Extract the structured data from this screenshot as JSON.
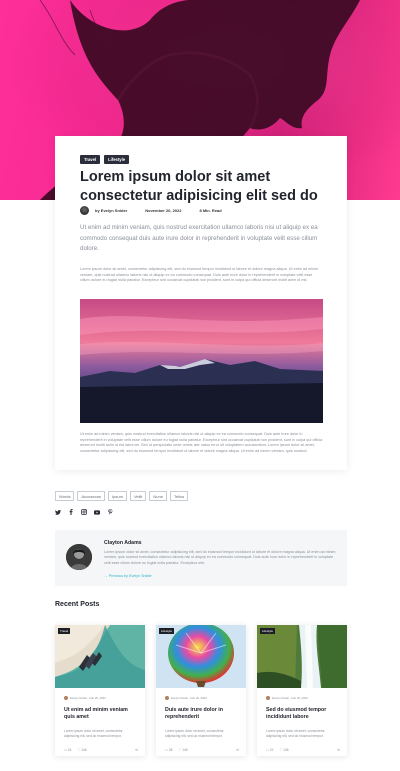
{
  "article": {
    "tags": [
      "Travel",
      "Lifestyle"
    ],
    "title": "Lorem ipsum dolor sit amet consectetur adipisicing elit sed do",
    "author": "by Evelyn Snider",
    "date": "November 20, 2022",
    "read_time": "8 Min. Read",
    "lead": "Ut enim ad minim veniam, quis nostrud exercitation ullamco laboris nisi ut aliquip ex ea commodo consequat duis aute irure dolor in reprehenderit in voluptate velit esse cillum dolore.",
    "body1": "Lorem ipsum dolor sit amet, consectetur adipisicing elit, sed do eiusmod tempor incididunt ut labore et dolore magna aliqua. Ut enim ad minim veniam, quis nostrud ullamco laboris nisi ut aliquip ex ea commodo consequat. Duis aute irure dolor in reprehenderit in voluptate velit esse cillum dolore eu fugiat nulla pariatur. Excepteur sint occaecat cupidatat non proident, sunt in culpa qui officia deserunt mollit anim id est.",
    "body2": "Ut enim ad minim veniam, quis nostrud exercitation ullamco laboris nisi ut aliquip ex ea commodo consequat. Duis aute irure dolor in reprehenderit in voluptate velit esse cillum dolore eu fugiat nulla pariatur. Excepteur sint occaecat cupidatat non proident, sunt in culpa qui officia deserunt mollit anim id est laborum. Sed ut perspiciatis unde omnis iste natus error sit voluptatem accusantium. Lorem ipsum dolor sit amet, consectetur adipisicing elit, sed do eiusmod tempor incididunt ut labore et dolore magna aliqua. Ut enim ad minim veniam, quis nostrud."
  },
  "tag_list": [
    "Words",
    "Accusecan",
    "Ipsum",
    "Veliit",
    "Nune",
    "Tellus"
  ],
  "social_icons": [
    "twitter-icon",
    "facebook-icon",
    "instagram-icon",
    "youtube-icon",
    "pinterest-icon"
  ],
  "author_box": {
    "name": "Clayton Adams",
    "bio": "Lorem ipsum dolor sit amet, consectetur adipisicing elit, sed do eiusmod tempor incididunt ut labore et dolore magna aliqua. Ut enim ad minim veniam, quis nostrud exercitation ullamco laboris nisi ut aliquip ex ea commodo consequat. Duis aute irure dolor in reprehenderit in voluptate velit esse cillum dolore eu fugiat nulla pariatur. Excepteur sint.",
    "more_link": "→ Previous by Evelyn Snider"
  },
  "recent": {
    "heading": "Recent Posts",
    "posts": [
      {
        "category": "Travel",
        "author": "Evelyn Snider",
        "date": "Feb 25, 2022",
        "title": "Ut enim ad minim veniam quis amet",
        "excerpt": "Lorem ipsum dolor sit amet, consectetur adipisicing elit, sed do eiusmod tempor.",
        "comments": "24",
        "likes": "146"
      },
      {
        "category": "Lifestyle",
        "author": "Evelyn Snider",
        "date": "Feb 26, 2022",
        "title": "Duis aute irure dolor in reprehenderit",
        "excerpt": "Lorem ipsum dolor sit amet, consectetur adipisicing elit, sed do eiusmod tempor.",
        "comments": "28",
        "likes": "146"
      },
      {
        "category": "Lifestyle",
        "author": "Evelyn Snider",
        "date": "Feb 26, 2022",
        "title": "Sed do eiusmod tempor incididunt labore",
        "excerpt": "Lorem ipsum dolor sit amet, consectetur adipisicing elit, sed do eiusmod tempor.",
        "comments": "22",
        "likes": "146"
      }
    ]
  },
  "colors": {
    "hero_pink": "#f0268c",
    "accent_teal": "#2cb3c9",
    "dark": "#22252d"
  }
}
